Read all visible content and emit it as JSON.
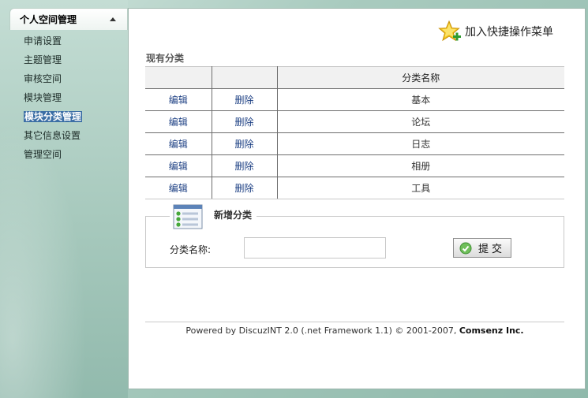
{
  "sidebar": {
    "title": "个人空间管理",
    "items": [
      {
        "label": "申请设置",
        "active": false
      },
      {
        "label": "主题管理",
        "active": false
      },
      {
        "label": "审核空间",
        "active": false
      },
      {
        "label": "模块管理",
        "active": false
      },
      {
        "label": "模块分类管理",
        "active": true
      },
      {
        "label": "其它信息设置",
        "active": false
      },
      {
        "label": "管理空间",
        "active": false
      }
    ]
  },
  "header": {
    "quick_add_label": "加入快捷操作菜单",
    "quick_add_icon": "star-plus-icon"
  },
  "main": {
    "section_title": "现有分类",
    "table": {
      "headers": [
        "",
        "",
        "分类名称"
      ],
      "rows": [
        {
          "edit": "编辑",
          "delete": "删除",
          "name": "基本"
        },
        {
          "edit": "编辑",
          "delete": "删除",
          "name": "论坛"
        },
        {
          "edit": "编辑",
          "delete": "删除",
          "name": "日志"
        },
        {
          "edit": "编辑",
          "delete": "删除",
          "name": "相册"
        },
        {
          "edit": "编辑",
          "delete": "删除",
          "name": "工具"
        }
      ]
    },
    "add_form": {
      "title": "新增分类",
      "name_label": "分类名称:",
      "name_value": "",
      "submit_label": "提交"
    }
  },
  "footer": {
    "powered_by": "Powered by",
    "product": "DiscuzINT 2.0",
    "framework": "(.net Framework 1.1)",
    "copyright": "© 2001-2007,",
    "company": "Comsenz Inc."
  },
  "colors": {
    "link": "#1c3f83",
    "active_menu_bg": "#3b6ea5",
    "sidebar_bg": "#a7c9bd"
  }
}
